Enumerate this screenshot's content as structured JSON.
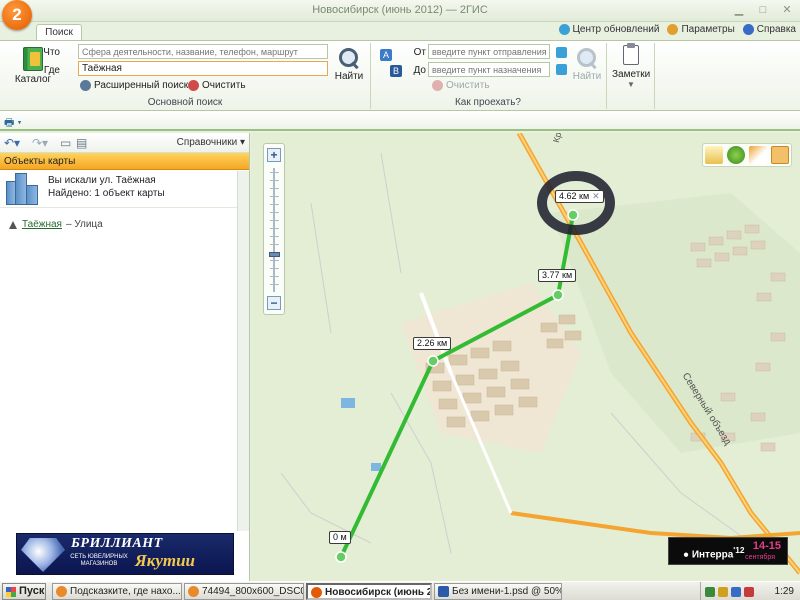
{
  "window": {
    "title": "Новосибирск (июнь 2012) — 2ГИС",
    "logo": "2"
  },
  "tabs": [
    {
      "label": "Поиск"
    }
  ],
  "top_links": {
    "updates": "Центр обновлений",
    "settings": "Параметры",
    "help": "Справка"
  },
  "ribbon": {
    "catalog_label": "Каталог",
    "search": {
      "what_label": "Что",
      "what_placeholder": "Сфера деятельности, название, телефон, маршрут",
      "where_label": "Где",
      "where_value": "Таёжная",
      "find_label": "Найти",
      "advanced_label": "Расширенный поиск",
      "clear_label": "Очистить",
      "group_label": "Основной поиск"
    },
    "route": {
      "from_label": "От",
      "from_placeholder": "введите пункт отправления",
      "to_label": "До",
      "to_placeholder": "введите пункт назначения",
      "find_label": "Найти",
      "clear_label": "Очистить",
      "group_label": "Как проехать?"
    },
    "notes_label": "Заметки"
  },
  "left_panel": {
    "reference_dropdown": "Справочники",
    "header": "Объекты карты",
    "searched_for": "Вы искали ул. Таёжная",
    "found": "Найдено: 1 объект карты",
    "results": [
      {
        "name": "Таёжная",
        "type": "– Улица"
      }
    ],
    "ad": {
      "brand": "БРИЛЛИАНТ",
      "tagline": "СЕТЬ ЮВЕЛИРНЫХ МАГАЗИНОВ",
      "name": "Якутии"
    }
  },
  "map": {
    "distance_markers": [
      "0 м",
      "2.26 км",
      "3.77 км",
      "4.62 км"
    ],
    "road_labels": {
      "north_bypass": "Северный объезд",
      "top_road": "Крас"
    },
    "ad": {
      "brand": "Интерра",
      "year": "'12",
      "dates": "14-15",
      "month": "сентября"
    },
    "route_color": "#33bb33",
    "road_color": "#f3a530"
  },
  "taskbar": {
    "start": "Пуск",
    "tasks": [
      {
        "label": "Подсказките, где нахо..."
      },
      {
        "label": "74494_800x600_DSC05..."
      },
      {
        "label": "Новосибирск (июнь 2..."
      },
      {
        "label": "Без имени-1.psd @ 50%..."
      }
    ],
    "clock": "1:29"
  }
}
